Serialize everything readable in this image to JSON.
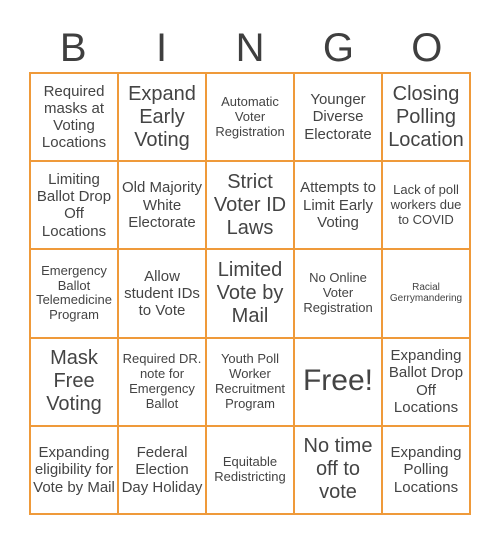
{
  "title_letters": [
    "B",
    "I",
    "N",
    "G",
    "O"
  ],
  "colors": {
    "grid_border": "#ef9a3a",
    "text": "#444444"
  },
  "cells": [
    {
      "text": "Required masks at Voting Locations",
      "size": "m"
    },
    {
      "text": "Expand Early Voting",
      "size": "l"
    },
    {
      "text": "Automatic Voter Registration",
      "size": "s"
    },
    {
      "text": "Younger Diverse Electorate",
      "size": "m"
    },
    {
      "text": "Closing Polling Location",
      "size": "l"
    },
    {
      "text": "Limiting Ballot Drop Off Locations",
      "size": "m"
    },
    {
      "text": "Old Majority White Electorate",
      "size": "m"
    },
    {
      "text": "Strict Voter ID Laws",
      "size": "l"
    },
    {
      "text": "Attempts to Limit Early Voting",
      "size": "m"
    },
    {
      "text": "Lack of poll workers due to COVID",
      "size": "s"
    },
    {
      "text": "Emergency Ballot Telemedicine Program",
      "size": "s"
    },
    {
      "text": "Allow student IDs to Vote",
      "size": "m"
    },
    {
      "text": "Limited Vote by Mail",
      "size": "l"
    },
    {
      "text": "No Online Voter Registration",
      "size": "s"
    },
    {
      "text": "Racial Gerrymandering",
      "size": "xs"
    },
    {
      "text": "Mask Free Voting",
      "size": "l"
    },
    {
      "text": "Required DR. note for Emergency Ballot",
      "size": "s"
    },
    {
      "text": "Youth Poll Worker Recruitment Program",
      "size": "s"
    },
    {
      "text": "Free!",
      "size": "xl"
    },
    {
      "text": "Expanding Ballot Drop Off Locations",
      "size": "m"
    },
    {
      "text": "Expanding eligibility for Vote by Mail",
      "size": "m"
    },
    {
      "text": "Federal Election Day Holiday",
      "size": "m"
    },
    {
      "text": "Equitable Redistricting",
      "size": "s"
    },
    {
      "text": "No time off to vote",
      "size": "l"
    },
    {
      "text": "Expanding Polling Locations",
      "size": "m"
    }
  ]
}
